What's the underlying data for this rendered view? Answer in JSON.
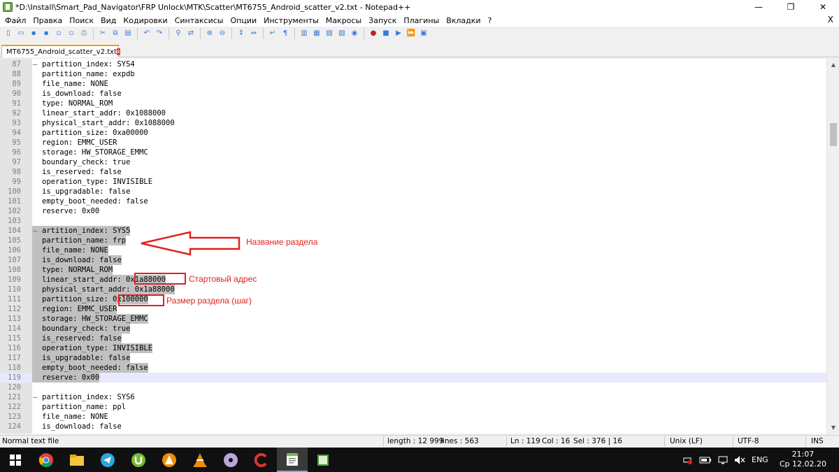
{
  "window": {
    "title": "*D:\\Install\\Smart_Pad_Navigator\\FRP Unlock\\MTK\\Scatter\\MT6755_Android_scatter_v2.txt - Notepad++",
    "minimize_glyph": "—",
    "restore_glyph": "❐",
    "close_glyph": "✕"
  },
  "menu": {
    "items": [
      "Файл",
      "Правка",
      "Поиск",
      "Вид",
      "Кодировки",
      "Синтаксисы",
      "Опции",
      "Инструменты",
      "Макросы",
      "Запуск",
      "Плагины",
      "Вкладки",
      "?"
    ],
    "close_glyph": "X"
  },
  "toolbar": {
    "icons": [
      "new-file-icon",
      "open-file-icon",
      "save-icon",
      "save-all-icon",
      "close-icon",
      "close-all-icon",
      "print-icon",
      "|",
      "cut-icon",
      "copy-icon",
      "paste-icon",
      "|",
      "undo-icon",
      "redo-icon",
      "|",
      "find-icon",
      "replace-icon",
      "|",
      "zoom-in-icon",
      "zoom-out-icon",
      "|",
      "sync-v-icon",
      "sync-h-icon",
      "|",
      "word-wrap-icon",
      "all-chars-icon",
      "|",
      "indent-guide-icon",
      "doc-map-icon",
      "function-list-icon",
      "folder-workspace-icon",
      "monitor-icon",
      "|",
      "record-macro-icon",
      "stop-macro-icon",
      "play-macro-icon",
      "run-macro-multiple-icon",
      "save-macro-icon"
    ],
    "accent": "#3a7bd5"
  },
  "tab": {
    "label": "MT6755_Android_scatter_v2.txt",
    "close_glyph": "x"
  },
  "editor": {
    "first_line": 87,
    "current_line": 119,
    "lines": [
      {
        "n": "87",
        "fold": "–",
        "text": "partition_index: SYS4",
        "sel": false
      },
      {
        "n": "88",
        "fold": "",
        "text": "partition_name: expdb",
        "sel": false
      },
      {
        "n": "89",
        "fold": "",
        "text": "file_name: NONE",
        "sel": false
      },
      {
        "n": "90",
        "fold": "",
        "text": "is_download: false",
        "sel": false
      },
      {
        "n": "91",
        "fold": "",
        "text": "type: NORMAL_ROM",
        "sel": false
      },
      {
        "n": "92",
        "fold": "",
        "text": "linear_start_addr: 0x1088000",
        "sel": false
      },
      {
        "n": "93",
        "fold": "",
        "text": "physical_start_addr: 0x1088000",
        "sel": false
      },
      {
        "n": "94",
        "fold": "",
        "text": "partition_size: 0xa00000",
        "sel": false
      },
      {
        "n": "95",
        "fold": "",
        "text": "region: EMMC_USER",
        "sel": false
      },
      {
        "n": "96",
        "fold": "",
        "text": "storage: HW_STORAGE_EMMC",
        "sel": false
      },
      {
        "n": "97",
        "fold": "",
        "text": "boundary_check: true",
        "sel": false
      },
      {
        "n": "98",
        "fold": "",
        "text": "is_reserved: false",
        "sel": false
      },
      {
        "n": "99",
        "fold": "",
        "text": "operation_type: INVISIBLE",
        "sel": false
      },
      {
        "n": "100",
        "fold": "",
        "text": "is_upgradable: false",
        "sel": false
      },
      {
        "n": "101",
        "fold": "",
        "text": "empty_boot_needed: false",
        "sel": false
      },
      {
        "n": "102",
        "fold": "",
        "text": "reserve: 0x00",
        "sel": false
      },
      {
        "n": "103",
        "fold": "",
        "text": "",
        "sel": false
      },
      {
        "n": "104",
        "fold": "–",
        "text": "artition_index: SYS5",
        "sel": true
      },
      {
        "n": "105",
        "fold": "",
        "text": "partition_name: frp",
        "sel": true
      },
      {
        "n": "106",
        "fold": "",
        "text": "file_name: NONE",
        "sel": true
      },
      {
        "n": "107",
        "fold": "",
        "text": "is_download: false",
        "sel": true
      },
      {
        "n": "108",
        "fold": "",
        "text": "type: NORMAL_ROM",
        "sel": true
      },
      {
        "n": "109",
        "fold": "",
        "text": "linear_start_addr: 0x1a88000",
        "sel": true
      },
      {
        "n": "110",
        "fold": "",
        "text": "physical_start_addr: 0x1a88000",
        "sel": true
      },
      {
        "n": "111",
        "fold": "",
        "text": "partition_size: 0x100000",
        "sel": true
      },
      {
        "n": "112",
        "fold": "",
        "text": "region: EMMC_USER",
        "sel": true
      },
      {
        "n": "113",
        "fold": "",
        "text": "storage: HW_STORAGE_EMMC",
        "sel": true
      },
      {
        "n": "114",
        "fold": "",
        "text": "boundary_check: true",
        "sel": true
      },
      {
        "n": "115",
        "fold": "",
        "text": "is_reserved: false",
        "sel": true
      },
      {
        "n": "116",
        "fold": "",
        "text": "operation_type: INVISIBLE",
        "sel": true
      },
      {
        "n": "117",
        "fold": "",
        "text": "is_upgradable: false",
        "sel": true
      },
      {
        "n": "118",
        "fold": "",
        "text": "empty_boot_needed: false",
        "sel": true
      },
      {
        "n": "119",
        "fold": "",
        "text": "reserve: 0x00",
        "sel": true
      },
      {
        "n": "120",
        "fold": "",
        "text": "",
        "sel": false
      },
      {
        "n": "121",
        "fold": "–",
        "text": "partition_index: SYS6",
        "sel": false
      },
      {
        "n": "122",
        "fold": "",
        "text": "partition_name: ppl",
        "sel": false
      },
      {
        "n": "123",
        "fold": "",
        "text": "file_name: NONE",
        "sel": false
      },
      {
        "n": "124",
        "fold": "",
        "text": "is_download: false",
        "sel": false
      }
    ]
  },
  "annotations": {
    "partition_name_label": "Название раздела",
    "start_addr_label": "Стартовый адрес",
    "size_label": "Размер раздела (шаг)",
    "color": "#e02020"
  },
  "statusbar": {
    "filetype": "Normal text file",
    "length": "length : 12 999",
    "lines": "lines : 563",
    "ln": "Ln : 119",
    "col": "Col : 16",
    "sel": "Sel : 376 | 16",
    "eol": "Unix (LF)",
    "encoding": "UTF-8",
    "mode": "INS"
  },
  "taskbar": {
    "apps": [
      "windows-start-icon",
      "chrome-icon",
      "file-explorer-icon",
      "telegram-icon",
      "utorrent-icon",
      "avast-icon",
      "vlc-icon",
      "dvd-icon",
      "ccleaner-icon",
      "notepad-plus-plus-icon",
      "terminal-icon"
    ],
    "lang": "ENG",
    "time": "21:07",
    "date": "Ср 12.02.20"
  }
}
